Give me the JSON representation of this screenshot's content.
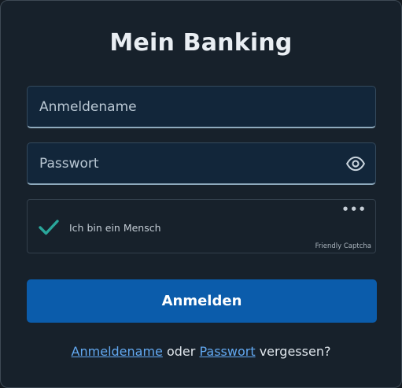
{
  "title": "Mein Banking",
  "form": {
    "username_placeholder": "Anmeldename",
    "username_value": "",
    "password_placeholder": "Passwort",
    "password_value": "",
    "password_toggle_icon": "eye-icon",
    "submit_label": "Anmelden"
  },
  "captcha": {
    "label": "Ich bin ein Mensch",
    "status_icon": "checkmark-icon",
    "menu_icon": "more-dots-icon",
    "menu_glyph": "•••",
    "brand": "Friendly Captcha"
  },
  "footer": {
    "username_link": "Anmeldename",
    "connector": "oder",
    "password_link": "Passwort",
    "suffix": "vergessen?"
  },
  "colors": {
    "background": "#17212b",
    "field_background": "#12263a",
    "primary_button": "#0b5cab",
    "link": "#62a8f0",
    "check": "#2aa79b"
  }
}
